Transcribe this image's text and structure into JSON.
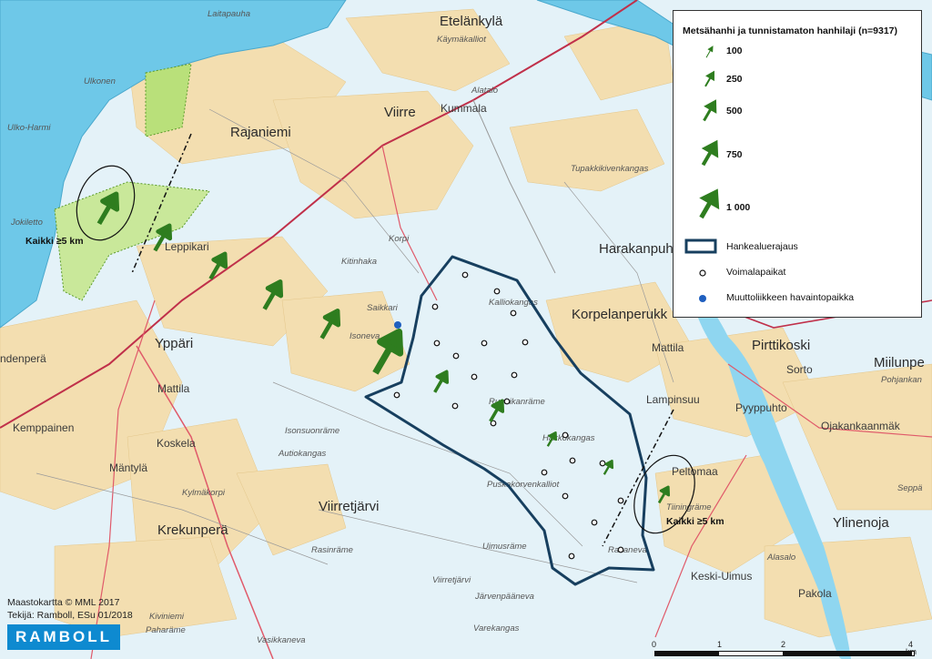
{
  "legend": {
    "title": "Metsähanhi ja tunnistamaton hanhilaji (n=9317)",
    "arrow_sizes": [
      {
        "label": "100"
      },
      {
        "label": "250"
      },
      {
        "label": "500"
      },
      {
        "label": "750"
      },
      {
        "label": "1 000"
      }
    ],
    "area_boundary": "Hankealuerajaus",
    "turbine_sites": "Voimalapaikat",
    "observation_site": "Muuttoliikkeen havaintopaikka"
  },
  "annotations": {
    "west_zone": "Kaikki ≥5 km",
    "east_zone": "Kaikki ≥5 km"
  },
  "credits": {
    "basemap": "Maastokartta © MML 2017",
    "author": "Tekijä: Ramboll, ESu 01/2018"
  },
  "logo": "RAMBOLL",
  "scale": {
    "ticks": [
      "0",
      "1",
      "2",
      "4"
    ],
    "unit": "km"
  },
  "places": {
    "etelankyla": "Etelänkylä",
    "kaymakallio": "Käymäkalliot",
    "laitapauha": "Laitapauha",
    "ulkonen": "Ulkonen",
    "ulko_harmi": "Ulko-Harmi",
    "rajaniemi": "Rajaniemi",
    "viirre": "Viirre",
    "kummala": "Kummala",
    "alatalo": "Alatalo",
    "tupakkikivenkangas": "Tupakkikivenkangas",
    "jokiletto": "Jokiletto",
    "leppikari": "Leppikari",
    "korpi": "Korpi",
    "harakanpuhto": "Harakanpuh",
    "kitinhaka": "Kitinhaka",
    "saikkari": "Saikkari",
    "kalliokangas": "Kalliokangas",
    "korpelanperukka": "Korpelanperukk",
    "isoneva": "Isoneva",
    "ypparii": "Yppäri",
    "ndenpera": "ndenperä",
    "mattila_w": "Mattila",
    "pirttikoski": "Pirttikoski",
    "mattila_e": "Mattila",
    "miilunpera": "Miilunpe",
    "sorto": "Sorto",
    "pohjankanka": "Pohjankan",
    "lampinsuu": "Lampinsuu",
    "pyyppuhto": "Pyyppuhto",
    "ojakankaanmaki": "Ojakankaanmäk",
    "kemppainen": "Kemppainen",
    "koskela": "Koskela",
    "isonsuonrame": "Isonsuonräme",
    "autiokangas": "Autiokangas",
    "ruuhikankrame": "Ruuhikanräme",
    "hakkokangas": "Hakkokangas",
    "mantyla": "Mäntylä",
    "kylmakorpi": "Kylmäkorpi",
    "puskakorvenkallio": "Puskakorvenkalliot",
    "peltomaa": "Peltomaa",
    "tiiningrame": "Tiiningräme",
    "seppa": "Seppä",
    "viirretjarvi": "Viirretjärvi",
    "rasinrame": "Rasinräme",
    "ylinenoja": "Ylinenoja",
    "krekunpera": "Krekunperä",
    "uimusrame": "Uimusräme",
    "rakaneva": "Rakaneva",
    "alasalo": "Alasalo",
    "keski_uimus": "Keski-Uimus",
    "viirretjarvi_s": "Viirretjärvi",
    "pakola": "Pakola",
    "jarvenpaaneva": "Järvenpääneva",
    "kiviniemi": "Kiviniemi",
    "paharame": "Paharäme",
    "vasikkaneva": "Vasikkaneva",
    "varekangas": "Varekangas"
  },
  "colors": {
    "arrow": "#2e7d1f",
    "boundary": "#173f5f",
    "observation": "#1f5fbf",
    "sea": "#6ec8e8",
    "field": "#f3deb0"
  }
}
